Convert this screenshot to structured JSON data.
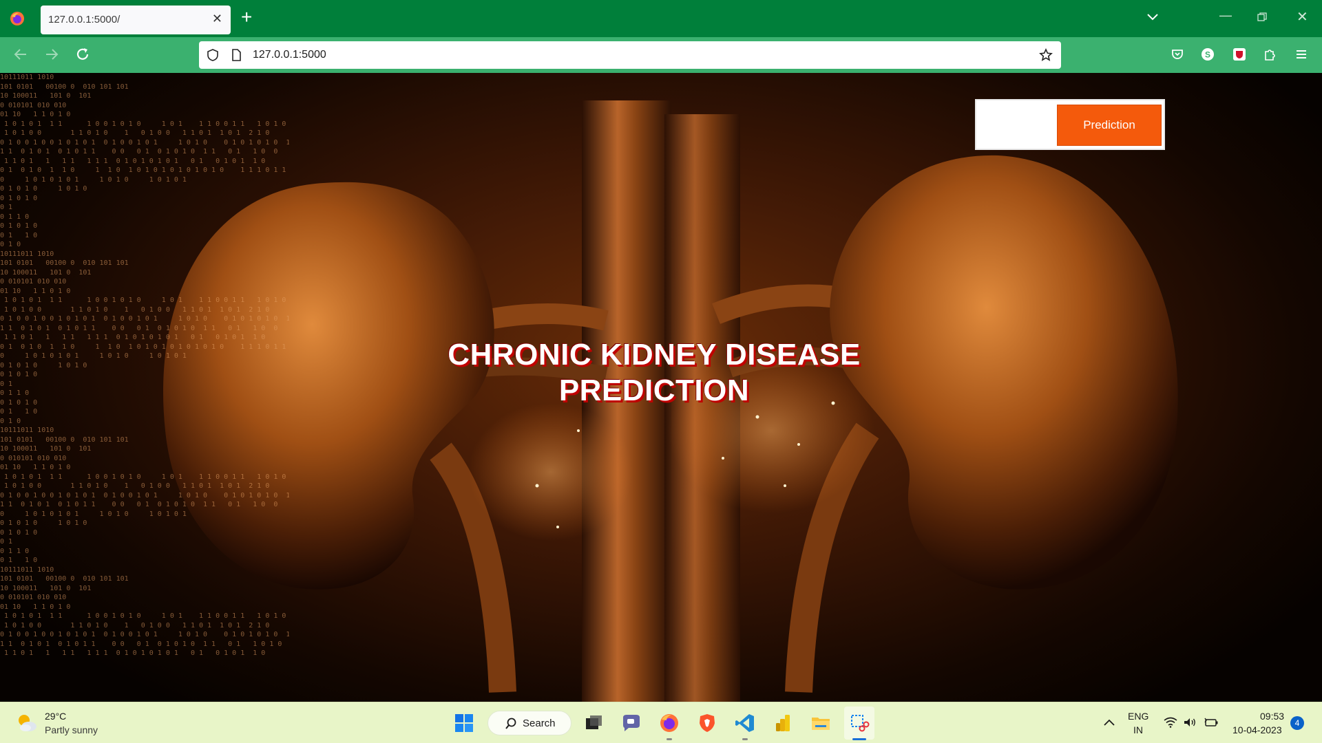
{
  "browser": {
    "tab_title": "127.0.0.1:5000/",
    "tab_close": "✕",
    "new_tab": "+",
    "url": "127.0.0.1:5000",
    "accent_color": "#007f3a",
    "toolbar_color": "#3bb16f"
  },
  "page": {
    "nav_button": "Prediction",
    "hero_title_line1": "CHRONIC KIDNEY DISEASE",
    "hero_title_line2": "PREDICTION",
    "button_color": "#f45a0c",
    "title_shadow_color": "#c00000",
    "background_image": "orange 3D kidney anatomy illustration with binary digits"
  },
  "taskbar": {
    "weather_temp": "29°C",
    "weather_desc": "Partly sunny",
    "search_label": "Search",
    "lang_line1": "ENG",
    "lang_line2": "IN",
    "time": "09:53",
    "date": "10-04-2023",
    "notification_count": "4",
    "apps": [
      "windows-start",
      "search",
      "task-view",
      "teams-chat",
      "firefox",
      "brave",
      "vscode",
      "power-bi",
      "file-explorer",
      "snipping-tool"
    ]
  }
}
